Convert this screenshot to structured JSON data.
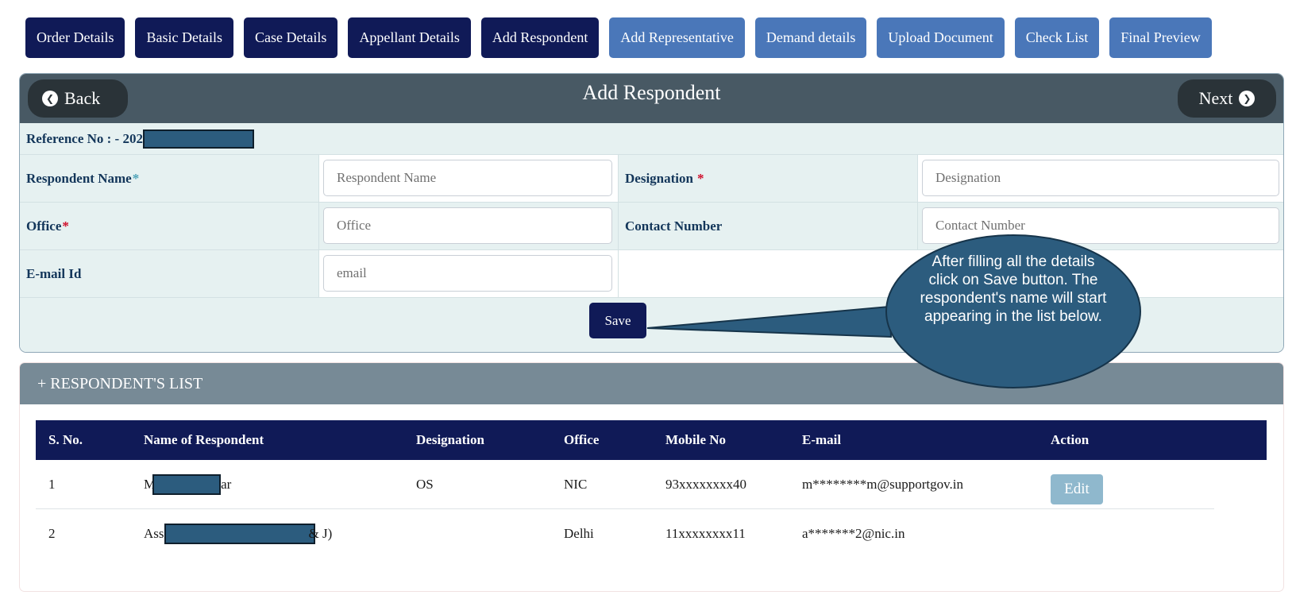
{
  "tabs": [
    {
      "label": "Order Details",
      "state": "done"
    },
    {
      "label": "Basic Details",
      "state": "done"
    },
    {
      "label": "Case Details",
      "state": "done"
    },
    {
      "label": "Appellant Details",
      "state": "done"
    },
    {
      "label": "Add Respondent",
      "state": "done"
    },
    {
      "label": "Add Representative",
      "state": "todo"
    },
    {
      "label": "Demand details",
      "state": "todo"
    },
    {
      "label": "Upload Document",
      "state": "todo"
    },
    {
      "label": "Check List",
      "state": "todo"
    },
    {
      "label": "Final Preview",
      "state": "todo"
    }
  ],
  "header": {
    "title": "Add Respondent",
    "back_label": "Back",
    "next_label": "Next"
  },
  "reference": {
    "label": "Reference No : - 202"
  },
  "form": {
    "respondent_name": {
      "label": "Respondent Name",
      "required": "*",
      "placeholder": "Respondent Name",
      "value": ""
    },
    "designation": {
      "label": "Designation",
      "required": "*",
      "placeholder": "Designation",
      "value": ""
    },
    "office": {
      "label": "Office",
      "required": "*",
      "placeholder": "Office",
      "value": ""
    },
    "contact_number": {
      "label": "Contact Number",
      "placeholder": "Contact Number",
      "value": ""
    },
    "email": {
      "label": "E-mail Id",
      "placeholder": "email",
      "value": ""
    },
    "save_label": "Save"
  },
  "callout": {
    "text": "After filling all the details click on Save button. The respondent's name will start appearing in the list below."
  },
  "list": {
    "title": "+ RESPONDENT'S LIST",
    "columns": [
      "S. No.",
      "Name of Respondent",
      "Designation",
      "Office",
      "Mobile No",
      "E-mail",
      "Action"
    ],
    "rows": [
      {
        "sno": "1",
        "name_start": "M",
        "name_end": "ar",
        "designation": "OS",
        "office": "NIC",
        "mobile": "93xxxxxxxx40",
        "email": "m********m@supportgov.in",
        "action": "Edit"
      },
      {
        "sno": "2",
        "name_start": "Ass",
        "name_end": "& J)",
        "designation": "",
        "office": "Delhi",
        "mobile": "11xxxxxxxx11",
        "email": "a*******2@nic.in",
        "action": ""
      }
    ]
  },
  "colors": {
    "tab_done": "#101a57",
    "tab_todo": "#4a77b9",
    "header_bar": "#485964",
    "row_shade": "#e6f1f1",
    "callout_fill": "#2c5c7e",
    "required": "#d0102c"
  },
  "icons": {
    "back": "arrow-circle-left-icon",
    "next": "arrow-circle-right-icon"
  }
}
